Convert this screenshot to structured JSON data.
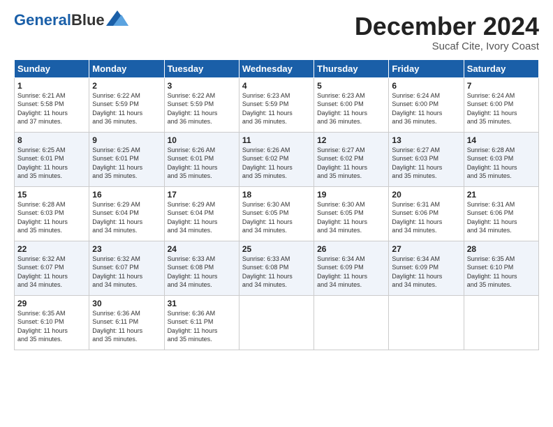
{
  "header": {
    "logo_general": "General",
    "logo_blue": "Blue",
    "month_title": "December 2024",
    "subtitle": "Sucaf Cite, Ivory Coast"
  },
  "weekdays": [
    "Sunday",
    "Monday",
    "Tuesday",
    "Wednesday",
    "Thursday",
    "Friday",
    "Saturday"
  ],
  "weeks": [
    [
      {
        "day": "1",
        "info": "Sunrise: 6:21 AM\nSunset: 5:58 PM\nDaylight: 11 hours\nand 37 minutes."
      },
      {
        "day": "2",
        "info": "Sunrise: 6:22 AM\nSunset: 5:59 PM\nDaylight: 11 hours\nand 36 minutes."
      },
      {
        "day": "3",
        "info": "Sunrise: 6:22 AM\nSunset: 5:59 PM\nDaylight: 11 hours\nand 36 minutes."
      },
      {
        "day": "4",
        "info": "Sunrise: 6:23 AM\nSunset: 5:59 PM\nDaylight: 11 hours\nand 36 minutes."
      },
      {
        "day": "5",
        "info": "Sunrise: 6:23 AM\nSunset: 6:00 PM\nDaylight: 11 hours\nand 36 minutes."
      },
      {
        "day": "6",
        "info": "Sunrise: 6:24 AM\nSunset: 6:00 PM\nDaylight: 11 hours\nand 36 minutes."
      },
      {
        "day": "7",
        "info": "Sunrise: 6:24 AM\nSunset: 6:00 PM\nDaylight: 11 hours\nand 35 minutes."
      }
    ],
    [
      {
        "day": "8",
        "info": "Sunrise: 6:25 AM\nSunset: 6:01 PM\nDaylight: 11 hours\nand 35 minutes."
      },
      {
        "day": "9",
        "info": "Sunrise: 6:25 AM\nSunset: 6:01 PM\nDaylight: 11 hours\nand 35 minutes."
      },
      {
        "day": "10",
        "info": "Sunrise: 6:26 AM\nSunset: 6:01 PM\nDaylight: 11 hours\nand 35 minutes."
      },
      {
        "day": "11",
        "info": "Sunrise: 6:26 AM\nSunset: 6:02 PM\nDaylight: 11 hours\nand 35 minutes."
      },
      {
        "day": "12",
        "info": "Sunrise: 6:27 AM\nSunset: 6:02 PM\nDaylight: 11 hours\nand 35 minutes."
      },
      {
        "day": "13",
        "info": "Sunrise: 6:27 AM\nSunset: 6:03 PM\nDaylight: 11 hours\nand 35 minutes."
      },
      {
        "day": "14",
        "info": "Sunrise: 6:28 AM\nSunset: 6:03 PM\nDaylight: 11 hours\nand 35 minutes."
      }
    ],
    [
      {
        "day": "15",
        "info": "Sunrise: 6:28 AM\nSunset: 6:03 PM\nDaylight: 11 hours\nand 35 minutes."
      },
      {
        "day": "16",
        "info": "Sunrise: 6:29 AM\nSunset: 6:04 PM\nDaylight: 11 hours\nand 34 minutes."
      },
      {
        "day": "17",
        "info": "Sunrise: 6:29 AM\nSunset: 6:04 PM\nDaylight: 11 hours\nand 34 minutes."
      },
      {
        "day": "18",
        "info": "Sunrise: 6:30 AM\nSunset: 6:05 PM\nDaylight: 11 hours\nand 34 minutes."
      },
      {
        "day": "19",
        "info": "Sunrise: 6:30 AM\nSunset: 6:05 PM\nDaylight: 11 hours\nand 34 minutes."
      },
      {
        "day": "20",
        "info": "Sunrise: 6:31 AM\nSunset: 6:06 PM\nDaylight: 11 hours\nand 34 minutes."
      },
      {
        "day": "21",
        "info": "Sunrise: 6:31 AM\nSunset: 6:06 PM\nDaylight: 11 hours\nand 34 minutes."
      }
    ],
    [
      {
        "day": "22",
        "info": "Sunrise: 6:32 AM\nSunset: 6:07 PM\nDaylight: 11 hours\nand 34 minutes."
      },
      {
        "day": "23",
        "info": "Sunrise: 6:32 AM\nSunset: 6:07 PM\nDaylight: 11 hours\nand 34 minutes."
      },
      {
        "day": "24",
        "info": "Sunrise: 6:33 AM\nSunset: 6:08 PM\nDaylight: 11 hours\nand 34 minutes."
      },
      {
        "day": "25",
        "info": "Sunrise: 6:33 AM\nSunset: 6:08 PM\nDaylight: 11 hours\nand 34 minutes."
      },
      {
        "day": "26",
        "info": "Sunrise: 6:34 AM\nSunset: 6:09 PM\nDaylight: 11 hours\nand 34 minutes."
      },
      {
        "day": "27",
        "info": "Sunrise: 6:34 AM\nSunset: 6:09 PM\nDaylight: 11 hours\nand 34 minutes."
      },
      {
        "day": "28",
        "info": "Sunrise: 6:35 AM\nSunset: 6:10 PM\nDaylight: 11 hours\nand 35 minutes."
      }
    ],
    [
      {
        "day": "29",
        "info": "Sunrise: 6:35 AM\nSunset: 6:10 PM\nDaylight: 11 hours\nand 35 minutes."
      },
      {
        "day": "30",
        "info": "Sunrise: 6:36 AM\nSunset: 6:11 PM\nDaylight: 11 hours\nand 35 minutes."
      },
      {
        "day": "31",
        "info": "Sunrise: 6:36 AM\nSunset: 6:11 PM\nDaylight: 11 hours\nand 35 minutes."
      },
      null,
      null,
      null,
      null
    ]
  ]
}
